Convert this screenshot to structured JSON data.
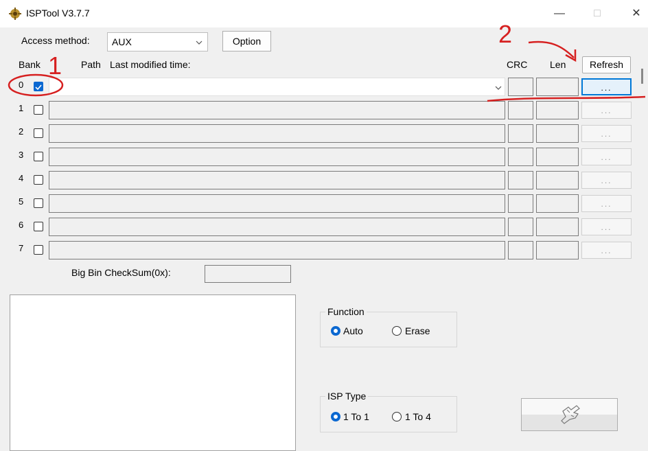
{
  "window": {
    "title": "ISPTool V3.7.7",
    "minimize_glyph": "—",
    "maximize_glyph": "□",
    "close_glyph": "✕"
  },
  "top": {
    "access_method_label": "Access method:",
    "access_method_value": "AUX",
    "option_button": "Option",
    "refresh_button": "Refresh"
  },
  "table": {
    "headers": {
      "bank": "Bank",
      "path": "Path",
      "last_modified": "Last modified time:",
      "crc": "CRC",
      "len": "Len"
    },
    "browse_label": "...",
    "rows": [
      {
        "bank": "0",
        "checked": true
      },
      {
        "bank": "1",
        "checked": false
      },
      {
        "bank": "2",
        "checked": false
      },
      {
        "bank": "3",
        "checked": false
      },
      {
        "bank": "4",
        "checked": false
      },
      {
        "bank": "5",
        "checked": false
      },
      {
        "bank": "6",
        "checked": false
      },
      {
        "bank": "7",
        "checked": false
      }
    ]
  },
  "checksum": {
    "label": "Big Bin CheckSum(0x):",
    "value": ""
  },
  "function_group": {
    "title": "Function",
    "options": [
      "Auto",
      "Erase"
    ],
    "selected": "Auto"
  },
  "isp_type_group": {
    "title": "ISP Type",
    "options": [
      "1 To 1",
      "1 To 4"
    ],
    "selected": "1 To 1"
  },
  "annotations": {
    "marker1": "1",
    "marker2": "2",
    "color": "#d62020"
  },
  "colors": {
    "accent": "#0078d7",
    "checkbox": "#0b68d1"
  }
}
